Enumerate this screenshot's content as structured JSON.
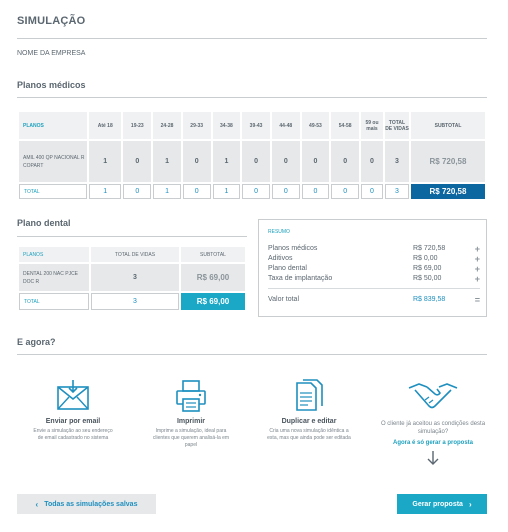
{
  "page": {
    "title": "SIMULAÇÃO",
    "company_label": "NOME DA EMPRESA"
  },
  "medical": {
    "section_title": "Planos médicos",
    "headers": [
      "PLANOS",
      "Até 18",
      "19-23",
      "24-28",
      "29-33",
      "34-38",
      "39-43",
      "44-48",
      "49-53",
      "54-58",
      "59 ou mais",
      "TOTAL DE VIDAS",
      "SUBTOTAL"
    ],
    "rows": [
      {
        "plan": "AMIL 400 QP NACIONAL R COPART",
        "values": [
          "1",
          "0",
          "1",
          "0",
          "1",
          "0",
          "0",
          "0",
          "0",
          "0"
        ],
        "total_lives": "3",
        "subtotal": "R$ 720,58"
      }
    ],
    "total": {
      "label": "TOTAL",
      "values": [
        "1",
        "0",
        "1",
        "0",
        "1",
        "0",
        "0",
        "0",
        "0",
        "0"
      ],
      "total_lives": "3",
      "subtotal": "R$ 720,58"
    }
  },
  "dental": {
    "section_title": "Plano dental",
    "headers": [
      "PLANOS",
      "TOTAL DE VIDAS",
      "SUBTOTAL"
    ],
    "rows": [
      {
        "plan": "DENTAL 200 NAC PJCE DOC R",
        "total_lives": "3",
        "subtotal": "R$ 69,00"
      }
    ],
    "total": {
      "label": "TOTAL",
      "total_lives": "3",
      "subtotal": "R$ 69,00"
    }
  },
  "summary": {
    "title": "RESUMO",
    "items": [
      {
        "label": "Planos médicos",
        "value": "R$ 720,58",
        "op": "+"
      },
      {
        "label": "Aditivos",
        "value": "R$ 0,00",
        "op": "+"
      },
      {
        "label": "Plano dental",
        "value": "R$ 69,00",
        "op": "+"
      },
      {
        "label": "Taxa de implantação",
        "value": "R$ 50,00",
        "op": "+"
      }
    ],
    "total": {
      "label": "Valor total",
      "value": "R$ 839,58",
      "op": "="
    }
  },
  "next_steps": {
    "section_title": "E agora?",
    "actions": [
      {
        "title": "Enviar por email",
        "description": "Envie a simulação ao seu endereço de email cadastrado no sistema",
        "icon": "envelope-icon"
      },
      {
        "title": "Imprimir",
        "description": "Imprime a simulação, ideal para clientes que querem analisá-la em papel",
        "icon": "printer-icon"
      },
      {
        "title": "Duplicar e editar",
        "description": "Cria uma nova simulação idêntica a esta, mas que ainda pode ser editada",
        "icon": "duplicate-document-icon"
      },
      {
        "title": "O cliente já aceitou as condições desta simulação?",
        "link": "Agora é só gerar a proposta",
        "icon": "handshake-icon"
      }
    ]
  },
  "buttons": {
    "back_label": "Todas as simulações salvas",
    "next_label": "Gerar proposta"
  },
  "colors": {
    "accent": "#1ba8c7",
    "primary_dark": "#0c66a0",
    "text": "#5b6770"
  }
}
